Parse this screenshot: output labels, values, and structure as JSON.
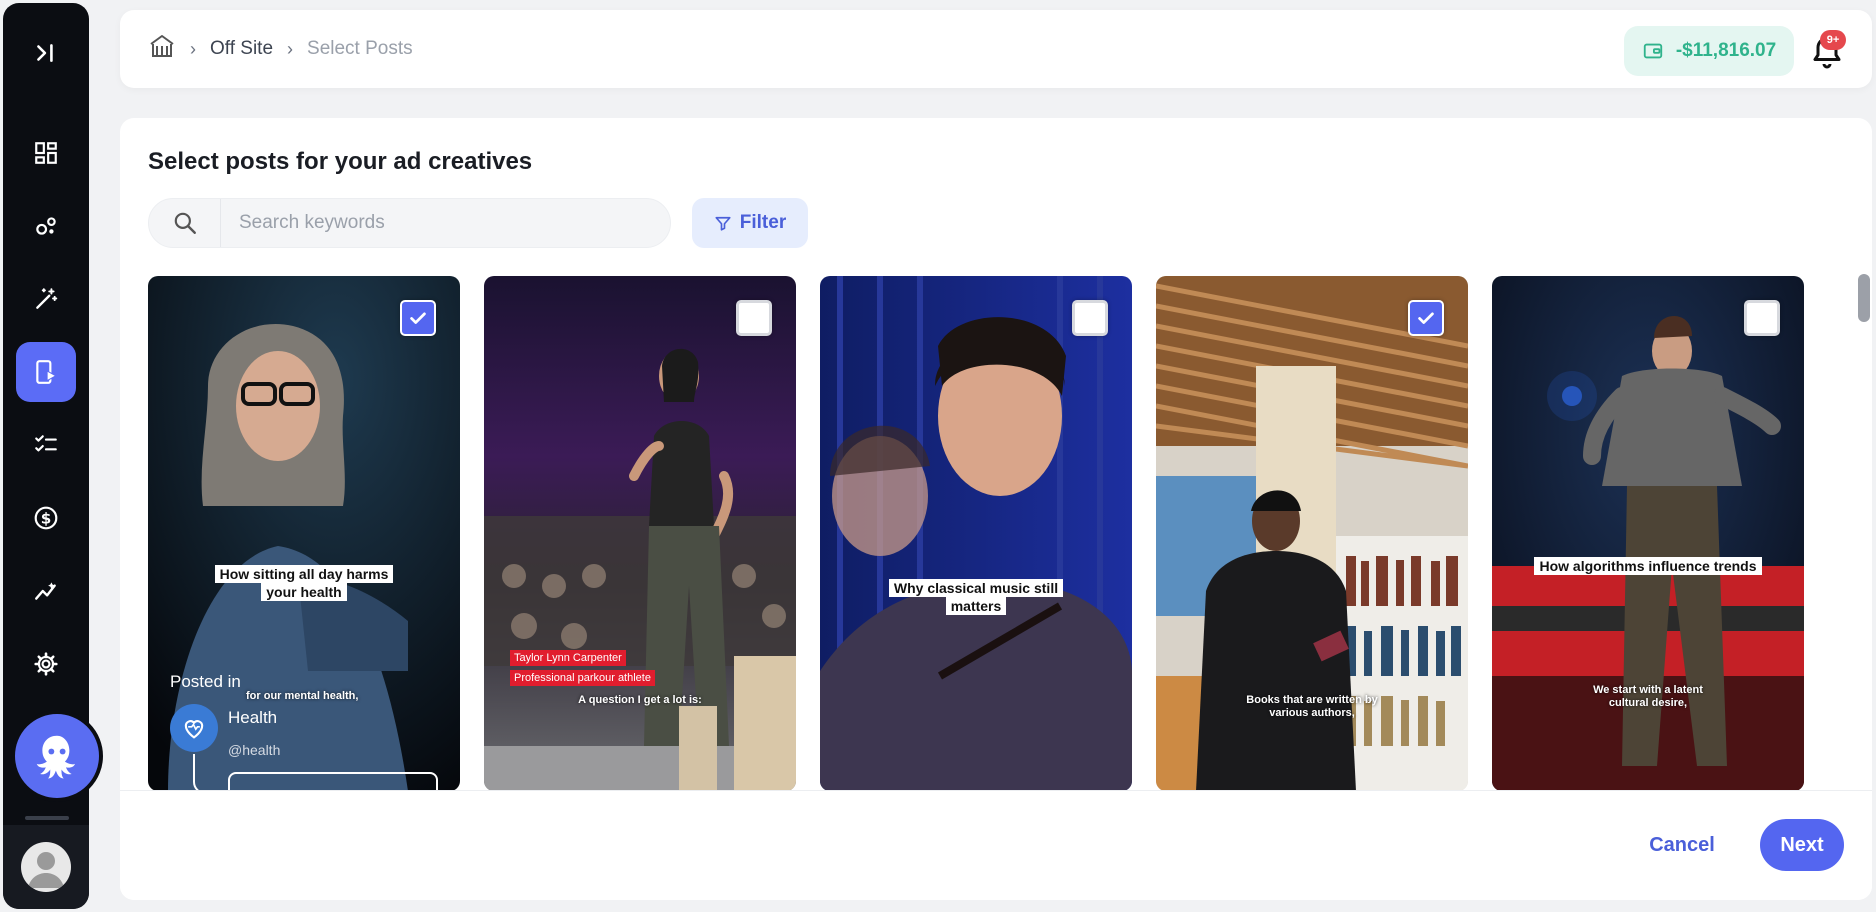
{
  "sidebar": {
    "items": [
      {
        "icon": "collapse-sidebar-icon",
        "active": false
      },
      {
        "icon": "dashboard-icon",
        "active": false
      },
      {
        "icon": "bubbles-icon",
        "active": false
      },
      {
        "icon": "magic-wand-icon",
        "active": false
      },
      {
        "icon": "mobile-video-icon",
        "active": true
      },
      {
        "icon": "checklist-icon",
        "active": false
      },
      {
        "icon": "dollar-icon",
        "active": false
      },
      {
        "icon": "analytics-icon",
        "active": false
      },
      {
        "icon": "gear-icon",
        "active": false
      }
    ],
    "assistant_icon": "octopus-icon",
    "profile_icon": "user-avatar-icon"
  },
  "header": {
    "breadcrumb": [
      "Off Site",
      "Select Posts"
    ],
    "balance": "-$11,816.07",
    "notification_badge": "9+"
  },
  "main": {
    "title": "Select posts for your ad creatives",
    "search": {
      "placeholder": "Search keywords",
      "value": ""
    },
    "filter_label": "Filter",
    "posts": [
      {
        "checked": true,
        "caption": "How sitting all day harms your health",
        "subtitle": "for our mental health,",
        "posted_in_label": "Posted in",
        "account_name": "Health",
        "account_handle": "@health"
      },
      {
        "checked": false,
        "caption": "",
        "subtitle": "A question I get a lot is:",
        "lower_third": [
          "Taylor Lynn Carpenter",
          "Professional parkour athlete"
        ]
      },
      {
        "checked": false,
        "caption": "Why classical music still matters",
        "subtitle": ""
      },
      {
        "checked": true,
        "caption": "",
        "subtitle": "Books that are written by various authors,"
      },
      {
        "checked": false,
        "caption": "How algorithms influence trends",
        "subtitle": "We start with a latent cultural desire,"
      }
    ]
  },
  "footer": {
    "cancel_label": "Cancel",
    "next_label": "Next"
  },
  "colors": {
    "accent": "#5466f0",
    "balance_text": "#2fb38c",
    "badge": "#e5484d"
  }
}
